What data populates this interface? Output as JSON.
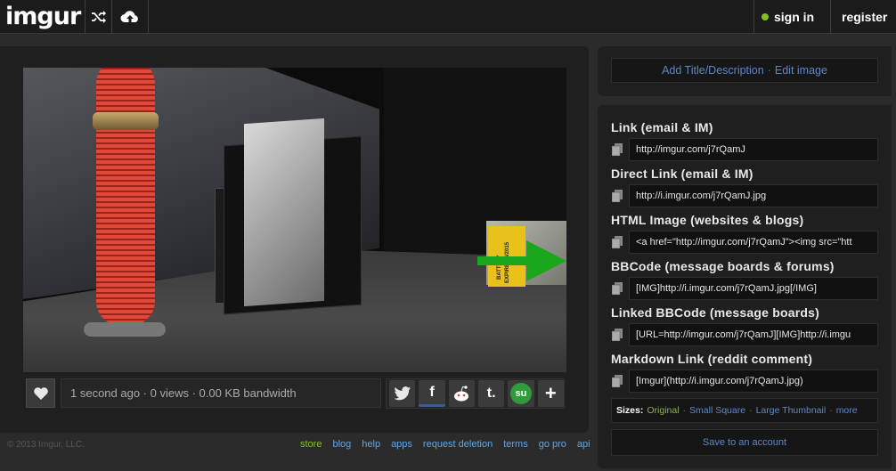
{
  "header": {
    "logo": "imgur",
    "signin_label": "sign in",
    "register_label": "register"
  },
  "photo": {
    "battery_text": "BATTERY EXPIRES 4/2015"
  },
  "image_actions": {
    "stats": "1 second ago · 0 views · 0.00 KB bandwidth",
    "share": [
      "t",
      "f",
      "reddit",
      "t.",
      "su",
      "+"
    ]
  },
  "right": {
    "edit_title": "Add Title/Description",
    "edit_image": "Edit image",
    "links": [
      {
        "label": "Link (email & IM)",
        "value": "http://imgur.com/j7rQamJ"
      },
      {
        "label": "Direct Link (email & IM)",
        "value": "http://i.imgur.com/j7rQamJ.jpg"
      },
      {
        "label": "HTML Image (websites & blogs)",
        "value": "<a href=\"http://imgur.com/j7rQamJ\"><img src=\"htt"
      },
      {
        "label": "BBCode (message boards & forums)",
        "value": "[IMG]http://i.imgur.com/j7rQamJ.jpg[/IMG]"
      },
      {
        "label": "Linked BBCode (message boards)",
        "value": "[URL=http://imgur.com/j7rQamJ][IMG]http://i.imgu"
      },
      {
        "label": "Markdown Link (reddit comment)",
        "value": "[Imgur](http://i.imgur.com/j7rQamJ.jpg)"
      }
    ],
    "sizes": {
      "label": "Sizes:",
      "original": "Original",
      "small_square": "Small Square",
      "large_thumbnail": "Large Thumbnail",
      "more": "more"
    },
    "save_label": "Save to an account"
  },
  "footer": {
    "copyright": "© 2013 Imgur, LLC.",
    "links": [
      "store",
      "blog",
      "help",
      "apps",
      "request deletion",
      "terms",
      "go pro",
      "api"
    ]
  },
  "colors": {
    "accent_green": "#85bf25",
    "link_blue": "#5f87c6",
    "background": "#2b2b2b",
    "panel": "#1f1f1f",
    "annotation_arrow": "#1ba71b"
  },
  "icons": [
    "shuffle-icon",
    "upload-icon",
    "heart-icon",
    "twitter-icon",
    "facebook-icon",
    "reddit-icon",
    "tumblr-icon",
    "stumbleupon-icon",
    "plus-icon",
    "copy-icon"
  ]
}
